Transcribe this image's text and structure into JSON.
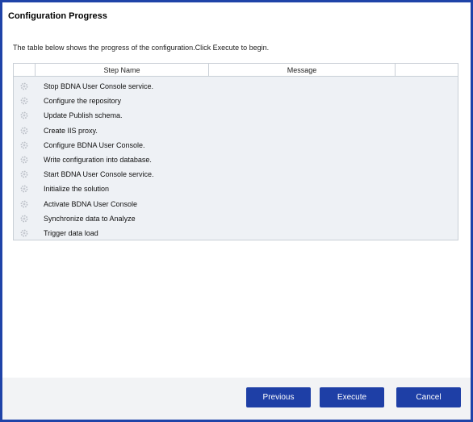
{
  "dialog": {
    "title": "Configuration Progress",
    "intro": "The table below shows the progress of the configuration.Click Execute to begin."
  },
  "table": {
    "columns": [
      "",
      "Step Name",
      "Message",
      ""
    ],
    "steps": [
      {
        "name": "Stop BDNA User Console service.",
        "icon": "pending-gear-icon"
      },
      {
        "name": "Configure the repository",
        "icon": "pending-gear-icon"
      },
      {
        "name": "Update Publish schema.",
        "icon": "pending-gear-icon"
      },
      {
        "name": "Create IIS proxy.",
        "icon": "pending-gear-icon"
      },
      {
        "name": "Configure BDNA User Console.",
        "icon": "pending-gear-icon"
      },
      {
        "name": "Write configuration into database.",
        "icon": "pending-gear-icon"
      },
      {
        "name": "Start BDNA User Console service.",
        "icon": "pending-gear-icon"
      },
      {
        "name": "Initialize the solution",
        "icon": "pending-gear-icon"
      },
      {
        "name": "Activate BDNA User Console",
        "icon": "pending-gear-icon"
      },
      {
        "name": "Synchronize data to Analyze",
        "icon": "pending-gear-icon"
      },
      {
        "name": "Trigger data load",
        "icon": "pending-gear-icon"
      }
    ]
  },
  "buttons": {
    "previous": "Previous",
    "execute": "Execute",
    "cancel": "Cancel"
  },
  "colors": {
    "accent": "#1e3fa6",
    "border": "#1f43a8"
  }
}
